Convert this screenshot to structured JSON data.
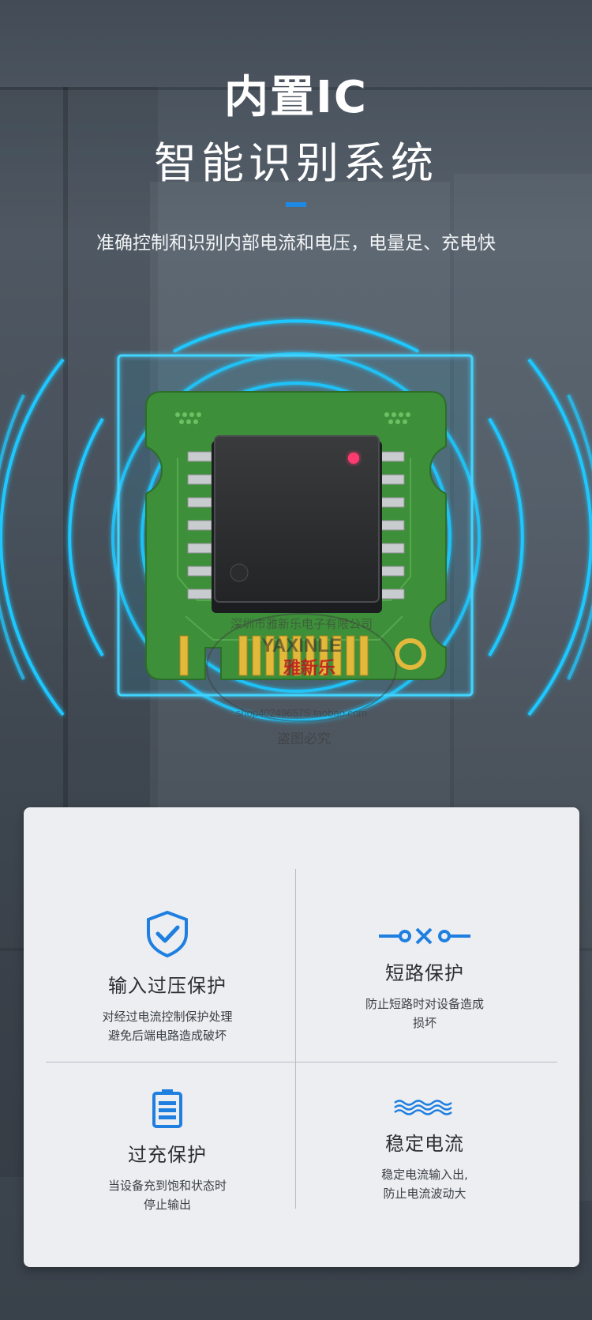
{
  "header": {
    "title": "内置IC",
    "subtitle": "智能识别系统",
    "description": "准确控制和识别内部电流和电压，电量足、充电快",
    "accent_color": "#1e88e5"
  },
  "chip_image": {
    "icon": "pcb-chip-illustration",
    "watermark_brand": "YAXINLE",
    "watermark_brand_cn": "雅新乐",
    "watermark_company": "深圳市雅新乐电子有限公司",
    "watermark_shop": "shop40249657S.taobao.com",
    "watermark_notice": "盗图必究",
    "ring_color": "#1ec8ff",
    "pcb_color": "#3e8f3a"
  },
  "features": [
    {
      "icon": "shield-check-icon",
      "title": "输入过压保护",
      "lines": [
        "对经过电流控制保护处理",
        "避免后端电路造成破坏"
      ]
    },
    {
      "icon": "short-circuit-icon",
      "title": "短路保护",
      "lines": [
        "防止短路时对设备造成",
        "损坏"
      ]
    },
    {
      "icon": "battery-icon",
      "title": "过充保护",
      "lines": [
        "当设备充到饱和状态时",
        "停止输出"
      ]
    },
    {
      "icon": "wave-icon",
      "title": "稳定电流",
      "lines": [
        "稳定电流输入出,",
        "防止电流波动大"
      ]
    }
  ]
}
